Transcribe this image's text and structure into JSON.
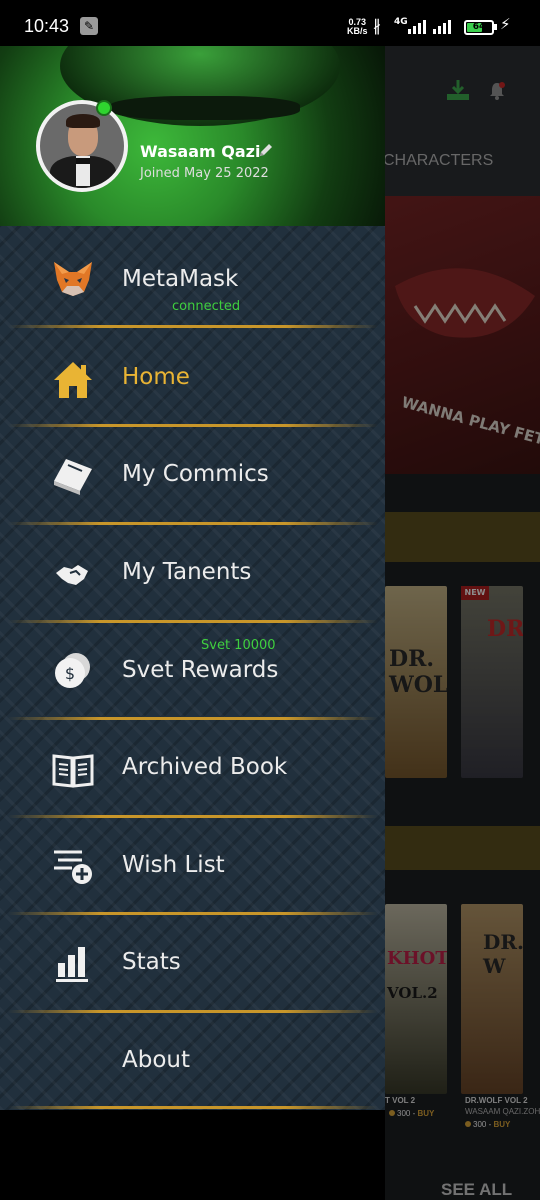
{
  "status_bar": {
    "time": "10:43",
    "speed_value": "0.73",
    "speed_unit": "KB/s",
    "network": "4G",
    "battery": "64",
    "battery_level": 0.64,
    "icons": [
      "wrench-icon",
      "bluetooth-icon",
      "signal-icon",
      "battery-icon",
      "charging-icon"
    ]
  },
  "background_app": {
    "tab_label": "CHARACTERS",
    "banner_text": "WANNA PLAY FETCH?",
    "comics": [
      {
        "cover_text": "DR. WOLF",
        "badge": ""
      },
      {
        "cover_text": "DR.",
        "badge": "NEW"
      },
      {
        "cover_text": "KHOT",
        "vol": "VOL.2",
        "caption": "T VOL 2",
        "price": "300",
        "buy": "BUY"
      },
      {
        "cover_text": "DR. W",
        "caption": "DR.WOLF VOL 2",
        "author": "WASAAM QAZI.ZOH",
        "price": "300",
        "buy": "BUY"
      }
    ],
    "see_all": "SEE ALL",
    "icons": [
      "download-icon",
      "bell-icon"
    ]
  },
  "drawer": {
    "user": {
      "name": "Wasaam Qazi",
      "joined": "Joined May 25 2022",
      "online": true
    },
    "menu": [
      {
        "id": "metamask",
        "label": "MetaMask",
        "sub": "connected",
        "icon": "fox-icon",
        "active": false
      },
      {
        "id": "home",
        "label": "Home",
        "icon": "home-icon",
        "active": true
      },
      {
        "id": "my-commics",
        "label": "My Commics",
        "icon": "book-icon",
        "active": false
      },
      {
        "id": "my-tanents",
        "label": "My Tanents",
        "icon": "handshake-icon",
        "active": false
      },
      {
        "id": "svet-rewards",
        "label": "Svet Rewards",
        "sub": "Svet 10000",
        "icon": "coins-icon",
        "active": false
      },
      {
        "id": "archived-book",
        "label": "Archived Book",
        "icon": "open-book-icon",
        "active": false
      },
      {
        "id": "wish-list",
        "label": "Wish List",
        "icon": "wishlist-add-icon",
        "active": false
      },
      {
        "id": "stats",
        "label": "Stats",
        "icon": "bar-chart-icon",
        "active": false
      },
      {
        "id": "about",
        "label": "About",
        "icon": "",
        "active": false
      }
    ],
    "colors": {
      "accent": "#e9b434",
      "sub_text": "#3fcf3f",
      "background": "#21303d"
    }
  }
}
